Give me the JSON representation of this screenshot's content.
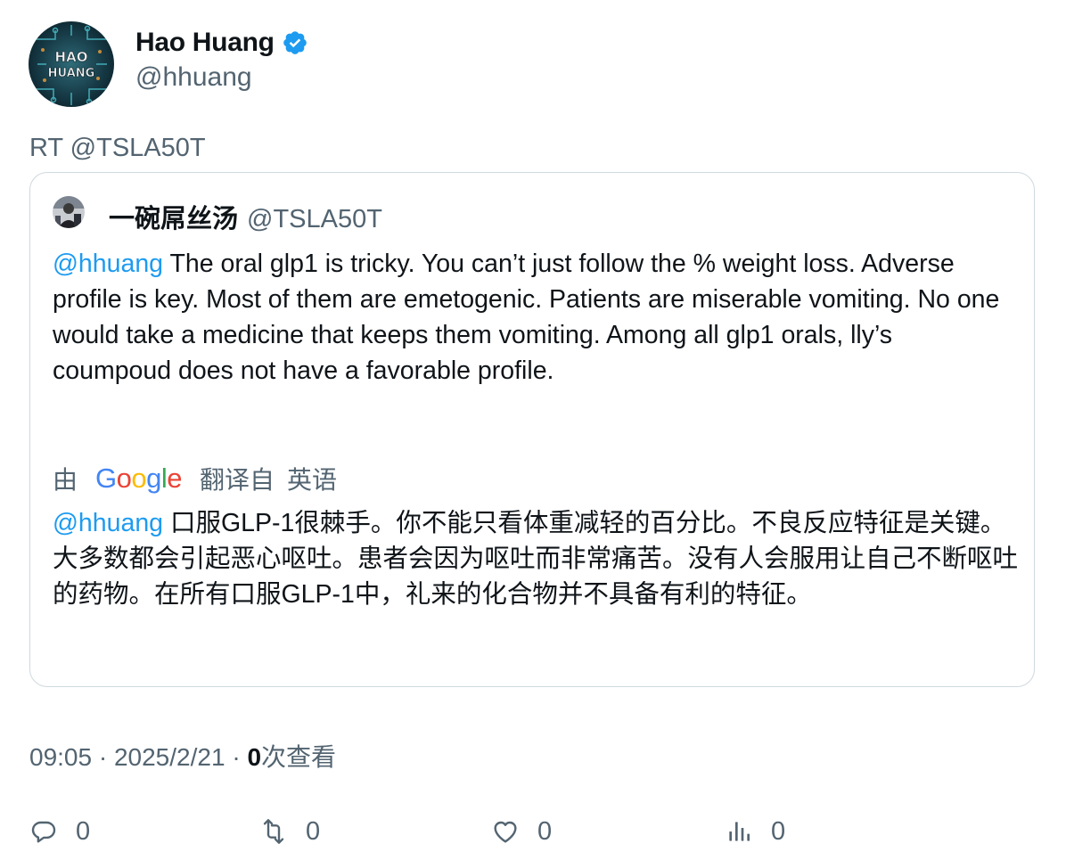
{
  "author": {
    "name": "Hao Huang",
    "handle": "@hhuang",
    "avatar_text_1": "HAO",
    "avatar_text_2": "HUANG",
    "verified_icon": "verified-badge-icon"
  },
  "retweet_line": "RT @TSLA50T",
  "quote": {
    "name": "一碗屌丝汤",
    "handle": "@TSLA50T",
    "mention": "@hhuang",
    "text": " The oral glp1 is tricky. You can’t just follow the % weight loss. Adverse profile is key. Most of them are emetogenic. Patients are miserable vomiting. No one would take a medicine that keeps them vomiting. Among all glp1 orals, lly’s coumpoud does not have a favorable profile.",
    "translate_prefix": "由",
    "translate_brand": {
      "G": "G",
      "o1": "o",
      "o2": "o",
      "g": "g",
      "l": "l",
      "e": "e"
    },
    "translate_label": "翻译自",
    "translate_lang": "英语",
    "translated_mention": "@hhuang",
    "translated_text": " 口服GLP-1很棘手。你不能只看体重减轻的百分比。不良反应特征是关键。大多数都会引起恶心呕吐。患者会因为呕吐而非常痛苦。没有人会服用让自己不断呕吐的药物。在所有口服GLP-1中，礼来的化合物并不具备有利的特征。"
  },
  "meta": {
    "time": "09:05",
    "sep1": " · ",
    "date": "2025/2/21",
    "sep2": " · ",
    "views_count": "0",
    "views_label": "次查看"
  },
  "actions": {
    "reply_count": "0",
    "retweet_count": "0",
    "like_count": "0",
    "views_count": "0"
  },
  "colors": {
    "text_primary": "#0f1419",
    "text_secondary": "#536471",
    "link": "#1d9bf0",
    "verified": "#1d9bf0",
    "border": "#cfd9de"
  }
}
